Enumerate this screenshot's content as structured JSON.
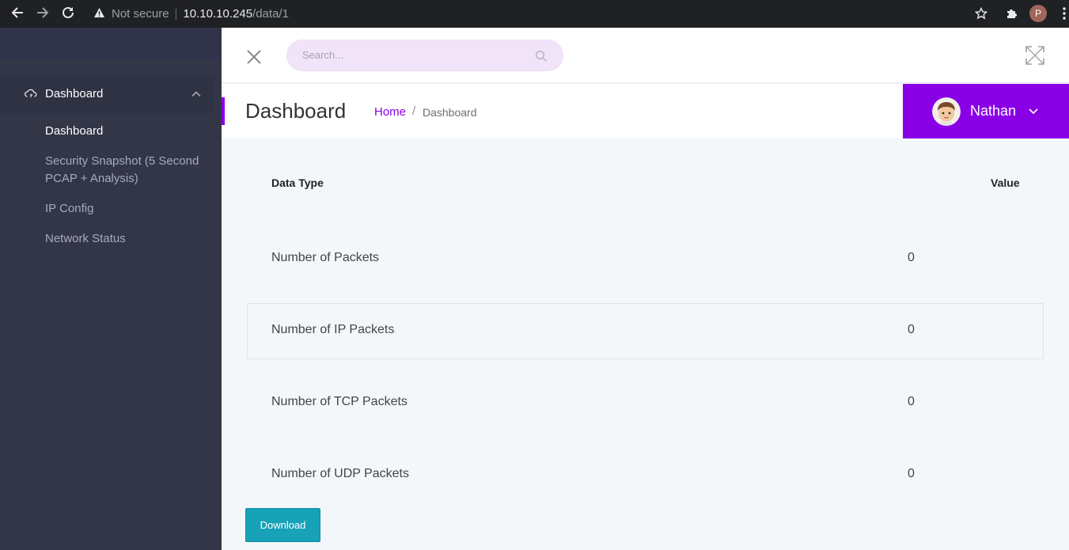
{
  "browser": {
    "security_label": "Not secure",
    "url_host": "10.10.10.245",
    "url_path": "/data/1",
    "profile_initial": "P"
  },
  "sidebar": {
    "section_label": "Dashboard",
    "items": [
      {
        "label": "Dashboard",
        "active": true
      },
      {
        "label": "Security Snapshot (5 Second PCAP + Analysis)",
        "active": false
      },
      {
        "label": "IP Config",
        "active": false
      },
      {
        "label": "Network Status",
        "active": false
      }
    ]
  },
  "topbar": {
    "search_placeholder": "Search..."
  },
  "header": {
    "title": "Dashboard",
    "breadcrumb_home": "Home",
    "breadcrumb_sep": "/",
    "breadcrumb_current": "Dashboard",
    "user_name": "Nathan",
    "accent_color": "#8a00e6"
  },
  "table": {
    "columns": [
      "Data Type",
      "Value"
    ],
    "rows": [
      {
        "type": "Number of Packets",
        "value": "0"
      },
      {
        "type": "Number of IP Packets",
        "value": "0"
      },
      {
        "type": "Number of TCP Packets",
        "value": "0"
      },
      {
        "type": "Number of UDP Packets",
        "value": "0"
      }
    ]
  },
  "actions": {
    "download_label": "Download",
    "download_color": "#17a2b8"
  }
}
